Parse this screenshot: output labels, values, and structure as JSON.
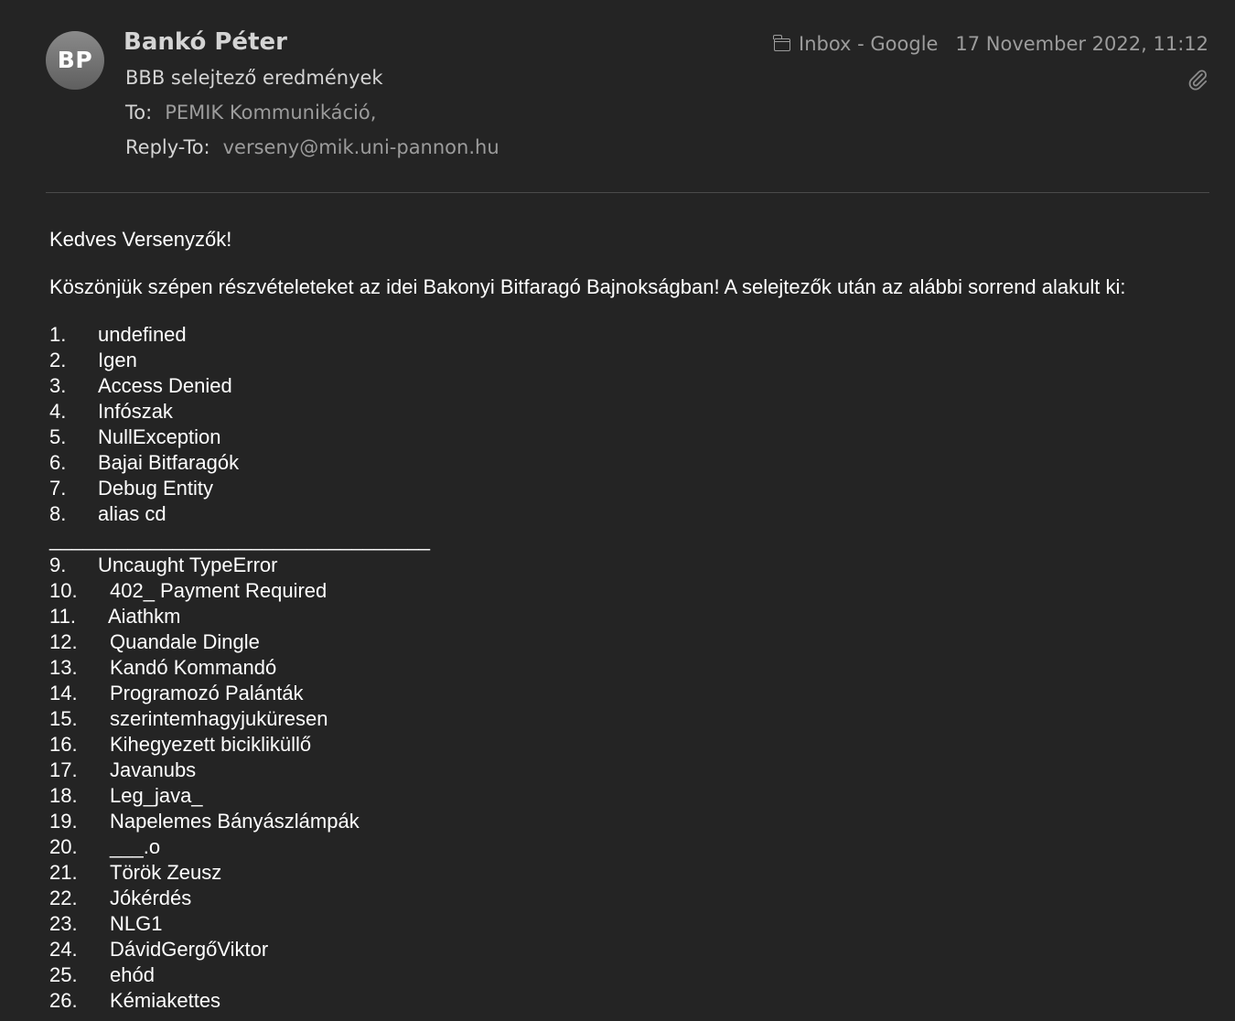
{
  "header": {
    "avatar_initials": "BP",
    "sender_name": "Bankó Péter",
    "subject": "BBB selejtező eredmények",
    "to_label": "To:",
    "to_value": "PEMIK Kommunikáció,",
    "reply_to_label": "Reply-To:",
    "reply_to_value": "verseny@mik.uni-pannon.hu",
    "mailbox": "Inbox - Google",
    "mailbox_icon": "folder-icon",
    "date": "17 November 2022, 11:12",
    "attachment_icon": "paperclip-icon"
  },
  "body": {
    "greeting": "Kedves Versenyzők!",
    "intro": "Köszönjük szépen részvételeteket az idei Bakonyi Bitfaragó Bajnokságban! A selejtezők után az alábbi sorrend alakult ki:",
    "separator": "__________________________________",
    "ranking_top": [
      {
        "num": "1.",
        "team": "undefined"
      },
      {
        "num": "2.",
        "team": "Igen"
      },
      {
        "num": "3.",
        "team": "Access Denied"
      },
      {
        "num": "4.",
        "team": "Infószak"
      },
      {
        "num": "5.",
        "team": "NullException"
      },
      {
        "num": "6.",
        "team": "Bajai Bitfaragók"
      },
      {
        "num": "7.",
        "team": "Debug Entity"
      },
      {
        "num": "8.",
        "team": "alias cd"
      }
    ],
    "ranking_rest": [
      {
        "num": "9.",
        "team": "Uncaught TypeError"
      },
      {
        "num": "10.",
        "team": "402_ Payment Required"
      },
      {
        "num": "11.",
        "team": "Aiathkm"
      },
      {
        "num": "12.",
        "team": "Quandale Dingle"
      },
      {
        "num": "13.",
        "team": "Kandó Kommandó"
      },
      {
        "num": "14.",
        "team": "Programozó Palánták"
      },
      {
        "num": "15.",
        "team": "szerintemhagyjuküresen"
      },
      {
        "num": "16.",
        "team": "Kihegyezett bicikliküllő"
      },
      {
        "num": "17.",
        "team": "Javanubs"
      },
      {
        "num": "18.",
        "team": "Leg_java_"
      },
      {
        "num": "19.",
        "team": "Napelemes Bányászlámpák"
      },
      {
        "num": "20.",
        "team": "___.o"
      },
      {
        "num": "21.",
        "team": "Török Zeusz"
      },
      {
        "num": "22.",
        "team": "Jókérdés"
      },
      {
        "num": "23.",
        "team": "NLG1"
      },
      {
        "num": "24.",
        "team": "DávidGergőViktor"
      },
      {
        "num": "25.",
        "team": "ehód"
      },
      {
        "num": "26.",
        "team": "Kémiakettes"
      }
    ]
  },
  "colors": {
    "background": "#242424",
    "header_primary_text": "#d4d4d4",
    "header_secondary_text": "#9c9c9c",
    "body_text": "#ffffff",
    "divider": "#4a4a4a"
  }
}
